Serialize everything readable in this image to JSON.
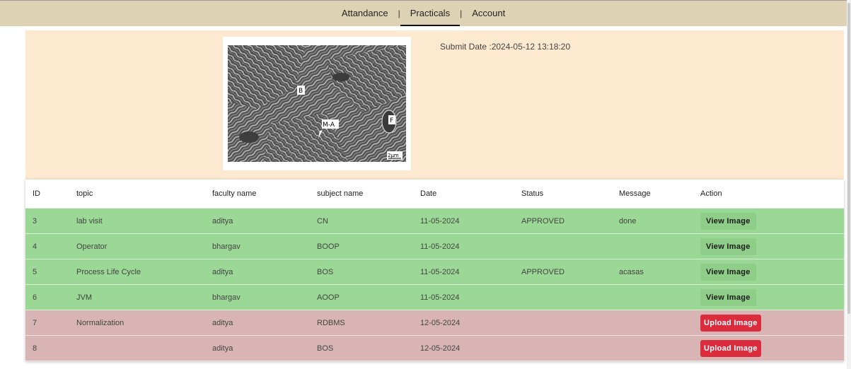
{
  "nav": {
    "items": [
      {
        "label": "Attandance"
      },
      {
        "label": "Practicals",
        "active": true
      },
      {
        "label": "Account"
      }
    ],
    "separator": "|"
  },
  "preview": {
    "submit_date": "Submit Date :2024-05-12 13:18:20",
    "image_labels": {
      "b": "B",
      "ma": "M-A",
      "f": "F",
      "scale": "2μm"
    }
  },
  "table": {
    "headers": [
      "ID",
      "topic",
      "faculty name",
      "subject name",
      "Date",
      "Status",
      "Message",
      "Action"
    ],
    "rows": [
      {
        "id": "3",
        "topic": "lab visit",
        "faculty": "aditya",
        "subject": "CN",
        "date": "11-05-2024",
        "status": "APPROVED",
        "message": "done",
        "action": "View Image",
        "kind": "green"
      },
      {
        "id": "4",
        "topic": "Operator",
        "faculty": "bhargav",
        "subject": "BOOP",
        "date": "11-05-2024",
        "status": "",
        "message": "",
        "action": "View Image",
        "kind": "green"
      },
      {
        "id": "5",
        "topic": "Process Life Cycle",
        "faculty": "aditya",
        "subject": "BOS",
        "date": "11-05-2024",
        "status": "APPROVED",
        "message": "acasas",
        "action": "View Image",
        "kind": "green"
      },
      {
        "id": "6",
        "topic": "JVM",
        "faculty": "bhargav",
        "subject": "AOOP",
        "date": "11-05-2024",
        "status": "",
        "message": "",
        "action": "View Image",
        "kind": "green"
      },
      {
        "id": "7",
        "topic": "Normalization",
        "faculty": "aditya",
        "subject": "RDBMS",
        "date": "12-05-2024",
        "status": "",
        "message": "",
        "action": "Upload Image",
        "kind": "red"
      },
      {
        "id": "8",
        "topic": "",
        "faculty": "aditya",
        "subject": "BOS",
        "date": "12-05-2024",
        "status": "",
        "message": "",
        "action": "Upload Image",
        "kind": "red"
      }
    ]
  },
  "colors": {
    "nav_bg": "#ddd3b4",
    "preview_bg": "#fce9d0",
    "row_approved": "#9bd795",
    "row_pending": "#d8b4b4",
    "upload_button": "#db2c3e"
  }
}
